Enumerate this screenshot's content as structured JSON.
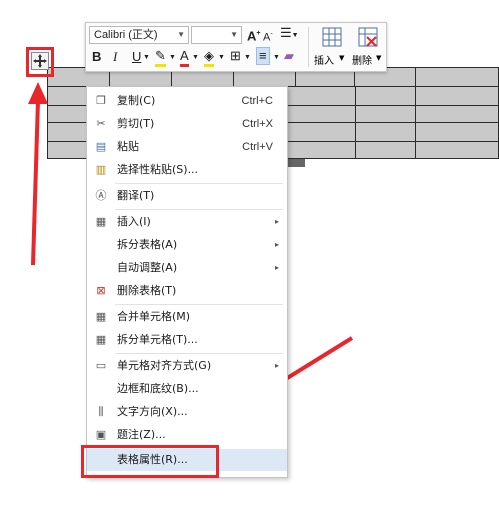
{
  "toolbar": {
    "font_name": "Calibri (正文)",
    "font_size": "",
    "grow_font_icon": "A",
    "shrink_font_icon": "A",
    "bold": "B",
    "italic": "I",
    "underline": "U",
    "font_color_icon": "A",
    "insert_label": "插入",
    "delete_label": "删除"
  },
  "context_menu": {
    "copy": {
      "label": "复制(C)",
      "shortcut": "Ctrl+C"
    },
    "cut": {
      "label": "剪切(T)",
      "shortcut": "Ctrl+X"
    },
    "paste": {
      "label": "粘贴",
      "shortcut": "Ctrl+V"
    },
    "paste_special": {
      "label": "选择性粘贴(S)..."
    },
    "translate": {
      "label": "翻译(T)"
    },
    "insert": {
      "label": "插入(I)"
    },
    "split_table": {
      "label": "拆分表格(A)"
    },
    "autofit": {
      "label": "自动调整(A)"
    },
    "delete_table": {
      "label": "删除表格(T)"
    },
    "merge_cells": {
      "label": "合并单元格(M)"
    },
    "split_cells": {
      "label": "拆分单元格(T)..."
    },
    "cell_alignment": {
      "label": "单元格对齐方式(G)"
    },
    "borders_shading": {
      "label": "边框和底纹(B)..."
    },
    "text_direction": {
      "label": "文字方向(X)..."
    },
    "caption": {
      "label": "题注(Z)..."
    },
    "table_properties": {
      "label": "表格属性(R)..."
    }
  },
  "colors": {
    "highlight_red": "#e8262b",
    "table_fill": "#c9c9c9",
    "menu_hover": "#dde8f6"
  }
}
